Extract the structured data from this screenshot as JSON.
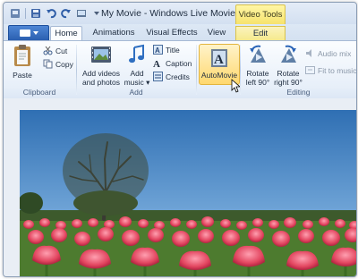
{
  "window": {
    "title": "My Movie - Windows Live Movie Maker",
    "context_tab_group": "Video Tools"
  },
  "quick_access": [
    "save-icon",
    "undo-icon",
    "redo-icon",
    "view-icon",
    "dropdown-icon"
  ],
  "tabs": [
    {
      "label": "Home",
      "active": true
    },
    {
      "label": "Animations",
      "active": false
    },
    {
      "label": "Visual Effects",
      "active": false
    },
    {
      "label": "View",
      "active": false
    },
    {
      "label": "Edit",
      "active": false,
      "contextual": true
    }
  ],
  "ribbon": {
    "clipboard": {
      "label": "Clipboard",
      "paste": "Paste",
      "cut": "Cut",
      "copy": "Copy"
    },
    "add": {
      "label": "Add",
      "add_videos_line1": "Add videos",
      "add_videos_line2": "and photos",
      "add_music_line1": "Add",
      "add_music_line2": "music",
      "title": "Title",
      "caption": "Caption",
      "credits": "Credits"
    },
    "automovie": {
      "label": "AutoMovie"
    },
    "editing": {
      "label": "Editing",
      "rotate_left_line1": "Rotate",
      "rotate_left_line2": "left 90°",
      "rotate_right_line1": "Rotate",
      "rotate_right_line2": "right 90°",
      "audio_mix": "Audio mix",
      "fit_to_music": "Fit to music"
    }
  },
  "colors": {
    "accent": "#2b5fb0",
    "contextual_tab": "#f6e26a",
    "highlight": "#ffd86f"
  }
}
